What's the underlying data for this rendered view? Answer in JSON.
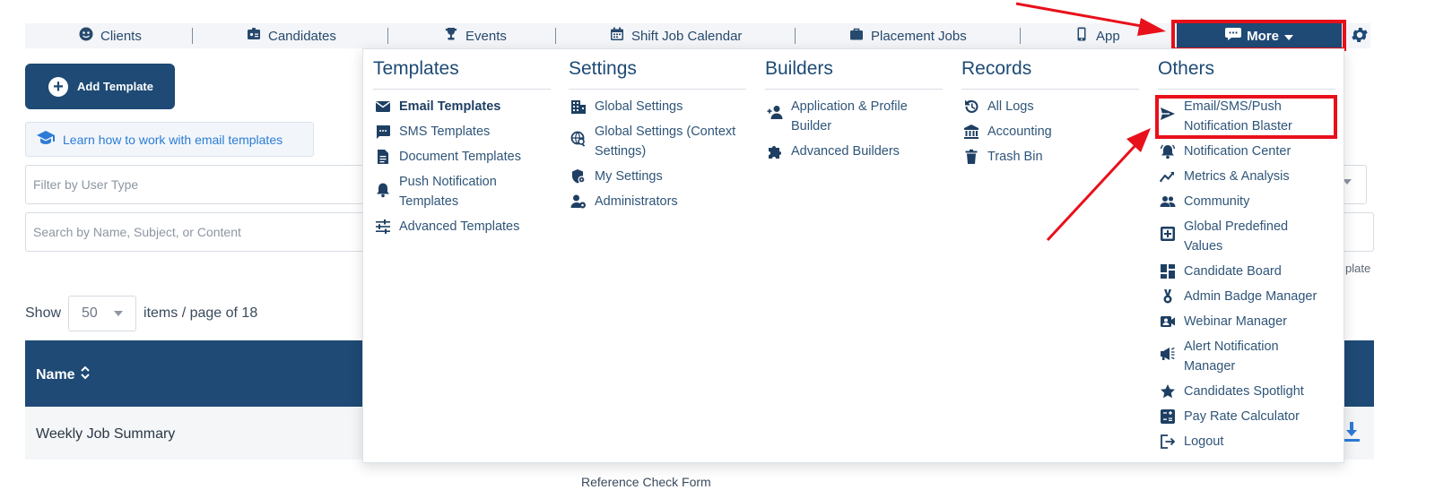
{
  "nav": {
    "items": [
      {
        "label": "Clients",
        "icon": "user-circle-icon"
      },
      {
        "label": "Candidates",
        "icon": "id-badge-icon"
      },
      {
        "label": "Events",
        "icon": "trophy-icon"
      },
      {
        "label": "Shift Job Calendar",
        "icon": "calendar-icon"
      },
      {
        "label": "Placement Jobs",
        "icon": "briefcase-icon"
      },
      {
        "label": "App",
        "icon": "phone-icon"
      }
    ],
    "more_label": "More",
    "settings_icon": "gear-icon"
  },
  "page": {
    "add_template_label": "Add Template",
    "learn_label": "Learn how to work with email templates",
    "filter_placeholder": "Filter by User Type",
    "search_placeholder": "Search by Name, Subject, or Content",
    "partial_text": "plate",
    "show_label": "Show",
    "page_size": "50",
    "items_label": "items / page of 18",
    "table_header_name": "Name",
    "row_name": "Weekly Job Summary",
    "bottom_cut_text": "Reference Check Form"
  },
  "menu": {
    "templates": {
      "title": "Templates",
      "items": [
        {
          "label": "Email Templates",
          "icon": "envelope-icon"
        },
        {
          "label": "SMS Templates",
          "icon": "chat-icon"
        },
        {
          "label": "Document Templates",
          "icon": "document-icon"
        },
        {
          "label": "Push Notification Templates",
          "icon": "bell-icon"
        },
        {
          "label": "Advanced Templates",
          "icon": "sliders-icon"
        }
      ]
    },
    "settings": {
      "title": "Settings",
      "items": [
        {
          "label": "Global Settings",
          "icon": "building-icon"
        },
        {
          "label": "Global Settings (Context Settings)",
          "icon": "globe-search-icon"
        },
        {
          "label": "My Settings",
          "icon": "shield-gear-icon"
        },
        {
          "label": "Administrators",
          "icon": "user-gear-icon"
        }
      ]
    },
    "builders": {
      "title": "Builders",
      "items": [
        {
          "label": "Application & Profile Builder",
          "icon": "user-plus-icon"
        },
        {
          "label": "Advanced Builders",
          "icon": "puzzle-icon"
        }
      ]
    },
    "records": {
      "title": "Records",
      "items": [
        {
          "label": "All Logs",
          "icon": "history-icon"
        },
        {
          "label": "Accounting",
          "icon": "bank-icon"
        },
        {
          "label": "Trash Bin",
          "icon": "trash-icon"
        }
      ]
    },
    "others": {
      "title": "Others",
      "items": [
        {
          "label": "Email/SMS/Push Notification Blaster",
          "icon": "send-icon"
        },
        {
          "label": "Notification Center",
          "icon": "bell-ring-icon"
        },
        {
          "label": "Metrics & Analysis",
          "icon": "trend-icon"
        },
        {
          "label": "Community",
          "icon": "people-icon"
        },
        {
          "label": "Global Predefined Values",
          "icon": "preset-icon"
        },
        {
          "label": "Candidate Board",
          "icon": "dashboard-icon"
        },
        {
          "label": "Admin Badge Manager",
          "icon": "medal-icon"
        },
        {
          "label": "Webinar Manager",
          "icon": "video-user-icon"
        },
        {
          "label": "Alert Notification Manager",
          "icon": "megaphone-icon"
        },
        {
          "label": "Candidates Spotlight",
          "icon": "star-icon"
        },
        {
          "label": "Pay Rate Calculator",
          "icon": "calculator-icon"
        },
        {
          "label": "Logout",
          "icon": "logout-icon"
        }
      ]
    }
  },
  "colors": {
    "primary": "#1e4a75",
    "highlight": "#e8101a",
    "link": "#2c7bd6"
  }
}
